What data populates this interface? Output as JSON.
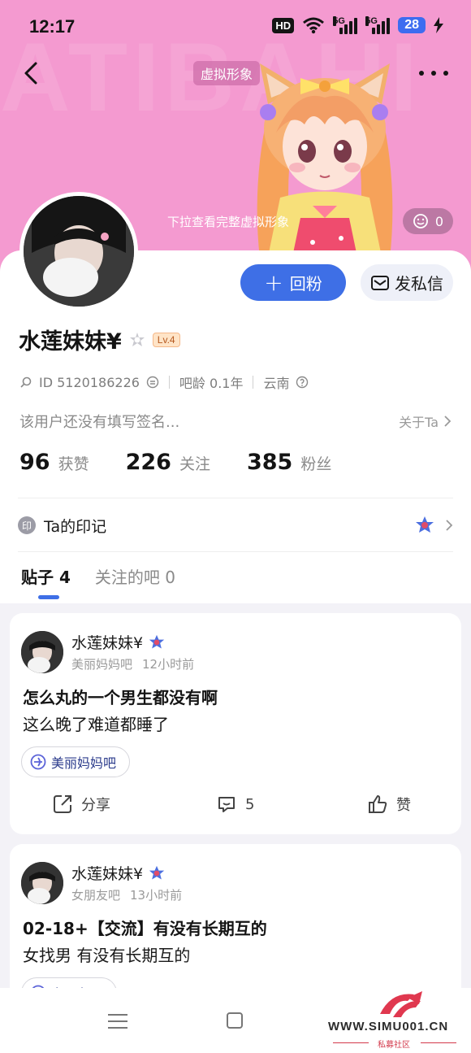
{
  "status_bar": {
    "time": "12:17",
    "hd_label": "HD",
    "hd_sub": "1 2",
    "sig1_label": "5G",
    "sig2_label": "5G",
    "battery": "28"
  },
  "header": {
    "avatar_tag": "虚拟形象",
    "pull_hint": "下拉查看完整虚拟形象",
    "like_count": "0",
    "watermark_text": "ATIBAHI"
  },
  "profile": {
    "follow_button": "回粉",
    "message_button": "发私信",
    "username": "水莲妹妹¥",
    "level": "Lv.4",
    "id_text": "ID 5120186226",
    "bar_age": "吧龄 0.1年",
    "location": "云南",
    "signature": "该用户还没有填写签名...",
    "about_label": "关于Ta",
    "stats": [
      {
        "num": "96",
        "label": "获赞"
      },
      {
        "num": "226",
        "label": "关注"
      },
      {
        "num": "385",
        "label": "粉丝"
      }
    ],
    "mark_icon": "印",
    "mark_label": "Ta的印记"
  },
  "tabs": [
    {
      "label": "贴子 4"
    },
    {
      "label": "关注的吧 0"
    }
  ],
  "posts": [
    {
      "author": "水莲妹妹¥",
      "forum": "美丽妈妈吧",
      "time": "12小时前",
      "title": "怎么丸的一个男生都没有啊",
      "body": "这么晚了难道都睡了",
      "chip": "美丽妈妈吧",
      "share": "分享",
      "comments": "5",
      "like": "赞"
    },
    {
      "author": "水莲妹妹¥",
      "forum": "女朋友吧",
      "time": "13小时前",
      "title": "02-18+【交流】有没有长期互的",
      "body": "女找男 有没有长期互的",
      "chip": "女朋友吧"
    }
  ],
  "watermark": {
    "url": "WWW.SIMU001.CN",
    "sub": "私募社区"
  },
  "colors": {
    "accent": "#3e6fe6",
    "hero": "#f49ad0"
  }
}
